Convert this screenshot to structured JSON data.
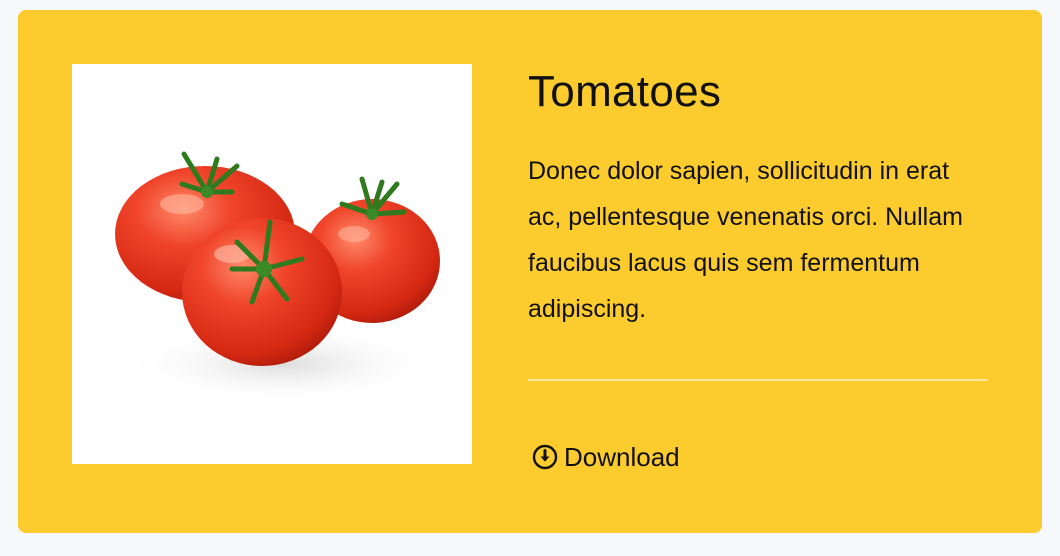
{
  "card": {
    "title": "Tomatoes",
    "description": "Donec dolor sapien, sollicitudin in erat ac, pellentesque venenatis orci. Nullam faucibus lacus quis sem fermentum adipiscing.",
    "image_alt": "Tomatoes",
    "download_label": "Download",
    "download_icon": "download-circle-icon",
    "accent_color": "#fccb2e"
  }
}
